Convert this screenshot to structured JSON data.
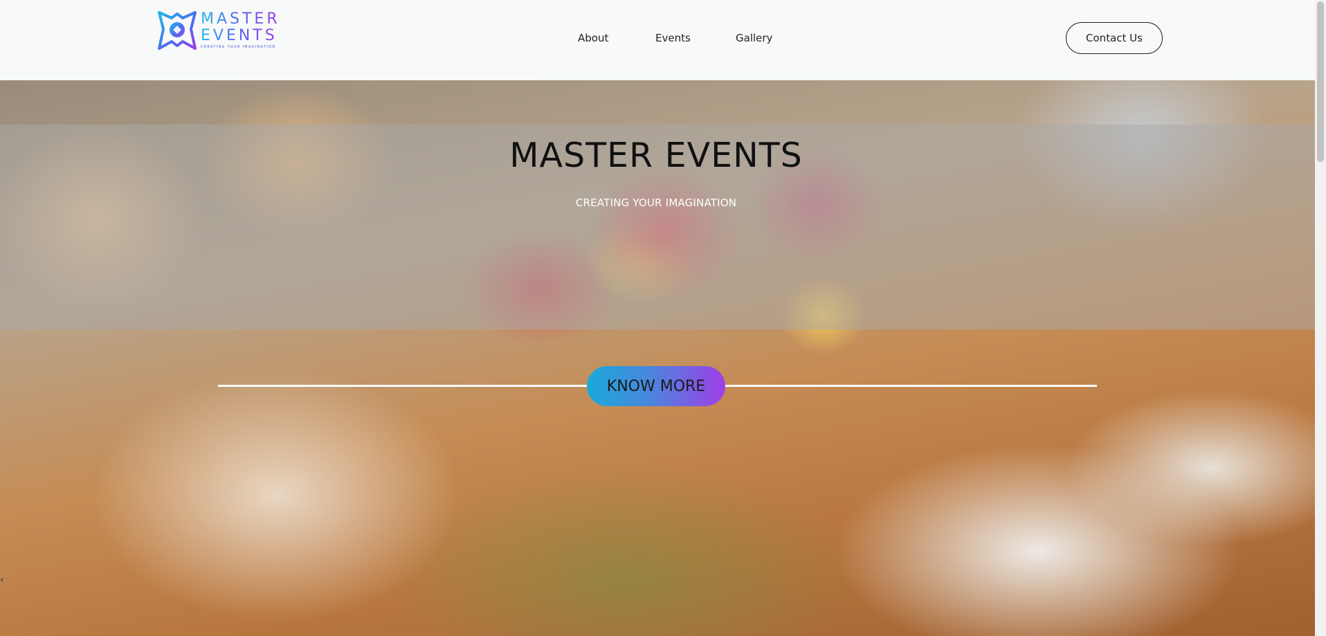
{
  "header": {
    "logo": {
      "word1": "MASTER",
      "word2": "EVENTS",
      "tagline": "CREATING YOUR IMAGINATION"
    },
    "nav": [
      {
        "label": "About"
      },
      {
        "label": "Events"
      },
      {
        "label": "Gallery"
      }
    ],
    "contact_label": "Contact Us"
  },
  "hero": {
    "title": "MASTER EVENTS",
    "subtitle": "CREATING YOUR IMAGINATION",
    "cta_label": "KNOW MORE",
    "prev_arrow": "‹"
  },
  "colors": {
    "brand_gradient_start": "#1aaad8",
    "brand_gradient_end": "#a03ee8",
    "header_bg": "#f8fafa"
  }
}
